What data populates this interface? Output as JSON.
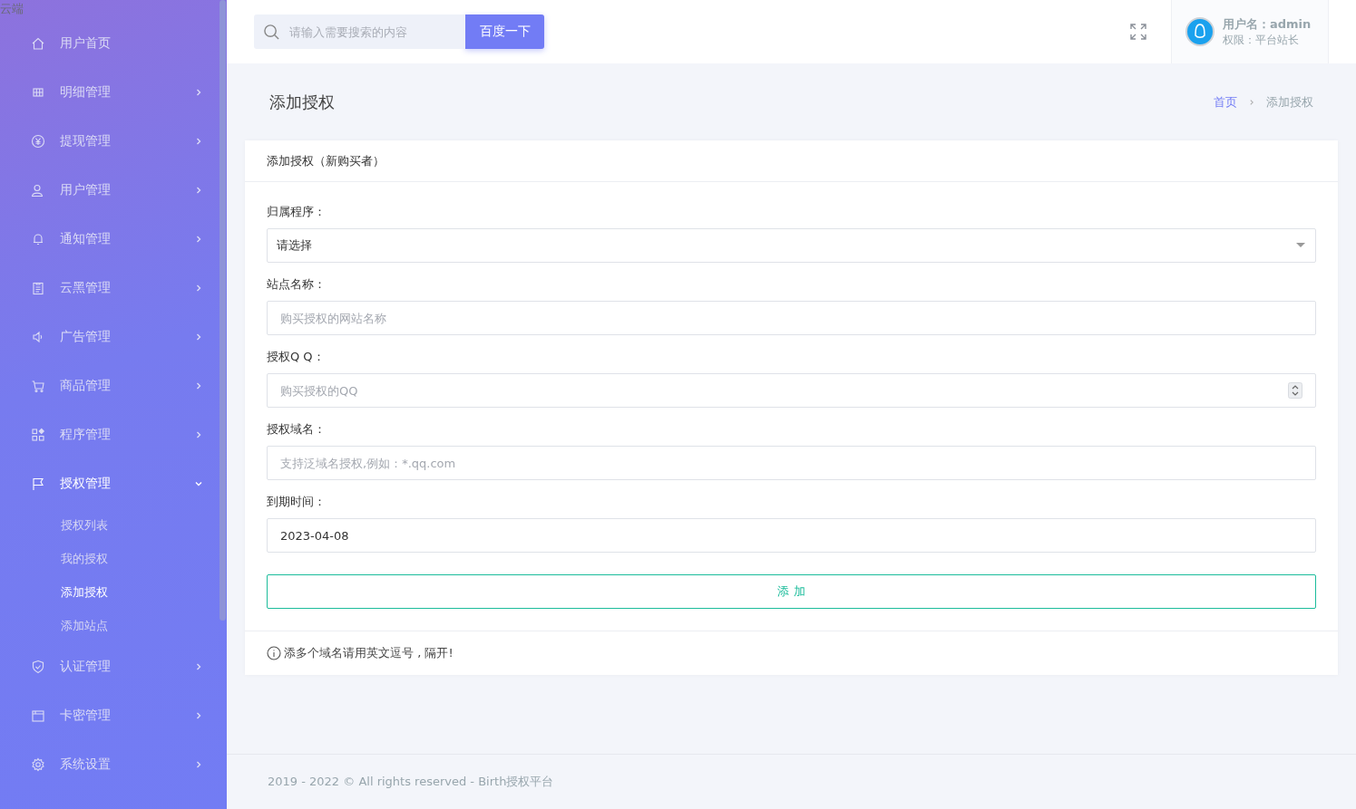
{
  "logo_text": "云端",
  "sidebar": {
    "items": [
      {
        "label": "用户首页",
        "selected": false
      },
      {
        "label": "明细管理",
        "selected": false,
        "expanded": false,
        "has_children": true
      },
      {
        "label": "提现管理",
        "selected": false,
        "expanded": false,
        "has_children": true
      },
      {
        "label": "用户管理",
        "selected": false,
        "expanded": false,
        "has_children": true
      },
      {
        "label": "通知管理",
        "selected": false,
        "expanded": false,
        "has_children": true
      },
      {
        "label": "云黑管理",
        "selected": false,
        "expanded": false,
        "has_children": true
      },
      {
        "label": "广告管理",
        "selected": false,
        "expanded": false,
        "has_children": true
      },
      {
        "label": "商品管理",
        "selected": false,
        "expanded": false,
        "has_children": true
      },
      {
        "label": "程序管理",
        "selected": false,
        "expanded": false,
        "has_children": true
      },
      {
        "label": "授权管理",
        "selected": true,
        "expanded": true,
        "has_children": true,
        "children": [
          {
            "label": "授权列表",
            "selected": false
          },
          {
            "label": "我的授权",
            "selected": false
          },
          {
            "label": "添加授权",
            "selected": true
          },
          {
            "label": "添加站点",
            "selected": false
          }
        ]
      },
      {
        "label": "认证管理",
        "selected": false,
        "expanded": false,
        "has_children": true
      },
      {
        "label": "卡密管理",
        "selected": false,
        "expanded": false,
        "has_children": true
      },
      {
        "label": "系统设置",
        "selected": false,
        "expanded": false,
        "has_children": true
      }
    ]
  },
  "header": {
    "search": {
      "placeholder": "请输入需要搜索的内容",
      "button": "百度一下"
    },
    "user": {
      "name": "用户名：admin",
      "role": "权限：平台站长"
    }
  },
  "page_title": "添加授权",
  "breadcrumb": [
    {
      "label": "首页",
      "selected": false
    },
    {
      "label": "添加授权",
      "selected": true
    }
  ],
  "card": {
    "title": "添加授权（新购买者）",
    "fields": [
      {
        "label": "归属程序：",
        "kind": "select",
        "value": "请选择"
      },
      {
        "label": "站点名称：",
        "kind": "text",
        "placeholder": "购买授权的网站名称"
      },
      {
        "label": "授权Q Q：",
        "kind": "number",
        "placeholder": "购买授权的QQ"
      },
      {
        "label": "授权域名：",
        "kind": "text",
        "placeholder": "支持泛域名授权,例如：*.qq.com"
      },
      {
        "label": "到期时间：",
        "kind": "text",
        "value": "2023-04-08"
      }
    ],
    "submit": "添 加",
    "note": "添多个域名请用英文逗号 , 隔开!"
  },
  "footer": "2019 - 2022 © All rights reserved - Birth授权平台"
}
